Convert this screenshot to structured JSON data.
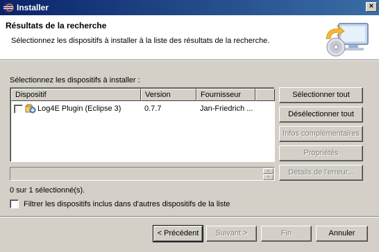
{
  "window": {
    "title": "Installer",
    "close_glyph": "×"
  },
  "banner": {
    "heading": "Résultats de la recherche",
    "description": "Sélectionnez les dispositifs à installer à la liste des résultats de la recherche."
  },
  "section_label": "Sélectionnez les dispositifs à installer :",
  "table": {
    "columns": [
      "Dispositif",
      "Version",
      "Fournisseur",
      ""
    ],
    "rows": [
      {
        "checked": false,
        "icon": "plugin-feature-icon",
        "name": "Log4E Plugin (Eclipse 3)",
        "version": "0.7.7",
        "provider": "Jan-Friedrich ..."
      }
    ]
  },
  "selection_count": "0 sur 1 sélectionné(s).",
  "filter_checkbox": {
    "checked": false,
    "label": "Filtrer les dispositifs inclus dans d'autres dispositifs de la liste"
  },
  "side_buttons": {
    "select_all": "Sélectionner tout",
    "deselect_all": "Désélectionner tout",
    "more_info": "Infos complémentaires",
    "properties": "Propriétés",
    "error_details": "Détails de l'erreur..."
  },
  "footer_buttons": {
    "back": "< Précédent",
    "next": "Suivant >",
    "finish": "Fin",
    "cancel": "Annuler"
  }
}
